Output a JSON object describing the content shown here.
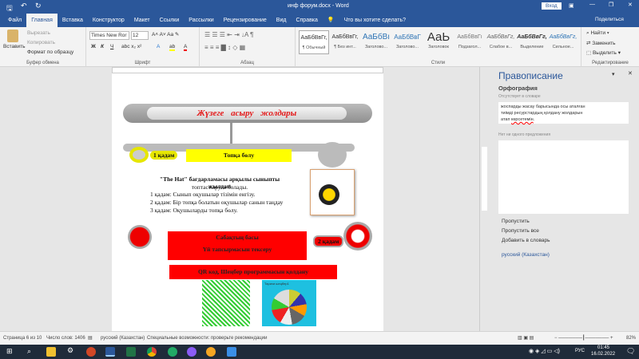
{
  "titlebar": {
    "title": "инф форум.docx - Word",
    "signin": "Вход"
  },
  "tabs": [
    "Файл",
    "Главная",
    "Вставка",
    "Конструктор",
    "Макет",
    "Ссылки",
    "Рассылки",
    "Рецензирование",
    "Вид",
    "Справка"
  ],
  "tell_me": "Что вы хотите сделать?",
  "share": "Поделиться",
  "clipboard": {
    "paste": "Вставить",
    "cut": "Вырезать",
    "copy": "Копировать",
    "format": "Формат по образцу",
    "label": "Буфер обмена"
  },
  "font": {
    "name": "Times New Ror",
    "size": "12",
    "label": "Шрифт",
    "bold": "Ж",
    "italic": "К",
    "underline": "Ч"
  },
  "paragraph": {
    "label": "Абзац"
  },
  "styles": {
    "label": "Стили",
    "items": [
      {
        "sample": "АаБбВвГг,",
        "name": "¶ Обычный"
      },
      {
        "sample": "АаБбВвГг,",
        "name": "¶ Без инт..."
      },
      {
        "sample": "АаБбВı",
        "name": "Заголово..."
      },
      {
        "sample": "АаБбВвГ",
        "name": "Заголово..."
      },
      {
        "sample": "АаЬ",
        "name": "Заголовок"
      },
      {
        "sample": "АаБбВвГı",
        "name": "Подзагол..."
      },
      {
        "sample": "АаБбВвГг,",
        "name": "Слабое в..."
      },
      {
        "sample": "АаБбВвГг,",
        "name": "Выделение"
      },
      {
        "sample": "АаБбВвГг,",
        "name": "Сильное..."
      }
    ]
  },
  "editing": {
    "find": "Найти",
    "replace": "Заменить",
    "select": "Выделить",
    "label": "Редактирование"
  },
  "document": {
    "heading": "Жүзеге асыру жолдары",
    "step1_badge": "1 қадам",
    "step1_title": "Топқа бөлу",
    "intro1": "\"The Hat\" бағдарламасы арқылы сыныпты жылдам",
    "intro2": "топтастыруға болады.",
    "steps": [
      "1 қадам: Сынып оқушылар тізімін енгізу.",
      "2 қадам: Бір топқа болатын оқушылар  санын таңдау",
      "3 қадам: Оқушыларды топқа бөлу."
    ],
    "step2_badge": "2 қадам",
    "lesson_start": "Сабақтың басы",
    "homework": "Үй тапсырмасын тексеру",
    "qr_title": "QR код, Шеңбер программасын қолдану",
    "wheel_title": "Тарихи шеңбер1"
  },
  "pane": {
    "title": "Правописание",
    "section": "Орфография",
    "missing": "Отсутствует в словаре",
    "context": [
      "жоспарды жасау барысында осы аталған",
      "тиімді ресурстардың қолдану жолдарын",
      "атап "
    ],
    "error_word": "көрсетемін",
    "context_end": ".",
    "no_suggestions": "Нет ни одного предложения",
    "skip": "Пропустить",
    "skip_all": "Пропустить все",
    "add": "Добавить в словарь",
    "language": "русский (Казахстан)"
  },
  "status": {
    "page": "Страница 6 из 10",
    "words": "Число слов: 1406",
    "language": "русский (Казахстан)",
    "accessibility": "Специальные возможности: проверьте рекомендации",
    "zoom": "82%"
  },
  "taskbar": {
    "lang": "РУС",
    "time": "01:45",
    "date": "16.02.2022"
  },
  "colors": {
    "word_blue": "#2b579a",
    "red": "#ff0000",
    "yellow": "#ffff00"
  }
}
